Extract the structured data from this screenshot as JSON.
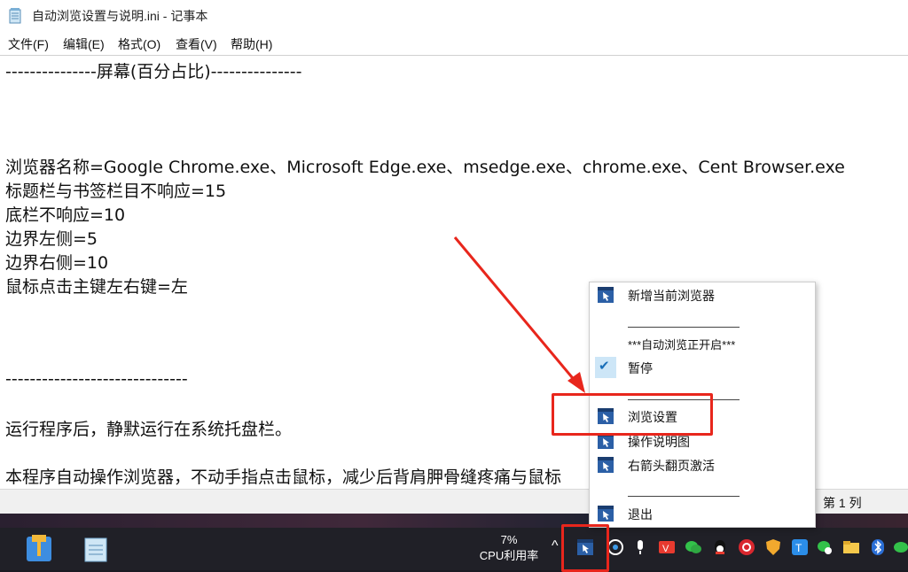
{
  "window": {
    "title": "自动浏览设置与说明.ini - 记事本"
  },
  "menu": [
    "文件(F)",
    "编辑(E)",
    "格式(O)",
    "查看(V)",
    "帮助(H)"
  ],
  "editor_lines": [
    "---------------屏幕(百分占比)---------------",
    "浏览器名称=Google Chrome.exe、Microsoft Edge.exe、msedge.exe、chrome.exe、Cent Browser.exe",
    "标题栏与书签栏目不响应=15",
    "底栏不响应=10",
    "边界左侧=5",
    "边界右侧=10",
    "鼠标点击主键左右键=左",
    "------------------------------",
    "运行程序后，静默运行在系统托盘栏。",
    "本程序自动操作浏览器，不动手指点击鼠标，减少后背肩胛骨缝疼痛与鼠标"
  ],
  "status": {
    "position": "第 1 列"
  },
  "taskbar": {
    "cpu_percent": "7%",
    "cpu_label": "CPU利用率",
    "chevron": "^"
  },
  "context_menu": {
    "add_browser": "新增当前浏览器",
    "status_text": "***自动浏览正开启***",
    "pause": "暂停",
    "browse_settings": "浏览设置",
    "manual": "操作说明图",
    "arrow_activate": "右箭头翻页激活",
    "exit": "退出"
  },
  "colors": {
    "annotation": "#e8261c",
    "check_bg": "#cde6f7",
    "taskbar": "#202027"
  }
}
